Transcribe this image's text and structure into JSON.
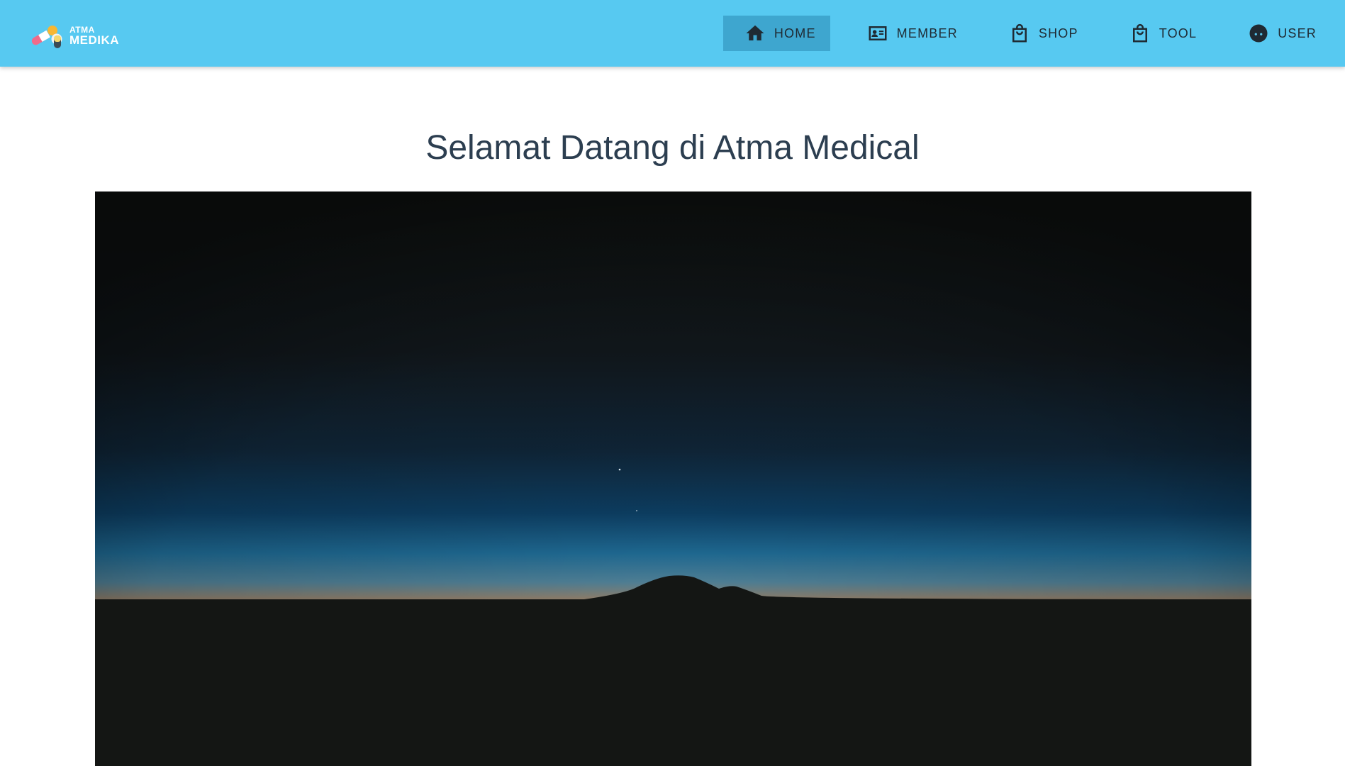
{
  "app": {
    "logo": {
      "line1": "ATMA",
      "line2": "MEDIKA"
    }
  },
  "nav": {
    "items": [
      {
        "label": "HOME",
        "icon": "home-icon",
        "active": true
      },
      {
        "label": "MEMBER",
        "icon": "id-card-icon",
        "active": false
      },
      {
        "label": "SHOP",
        "icon": "shopping-bag-icon",
        "active": false
      },
      {
        "label": "TOOL",
        "icon": "shopping-bag-icon",
        "active": false
      },
      {
        "label": "USER",
        "icon": "user-face-icon",
        "active": false
      }
    ]
  },
  "main": {
    "title": "Selamat Datang di Atma Medical"
  },
  "colors": {
    "navbar": "#57c9f1",
    "nav_active": "#3ea6cf",
    "nav_text": "#1f2a33",
    "title_text": "#2c3e50"
  }
}
